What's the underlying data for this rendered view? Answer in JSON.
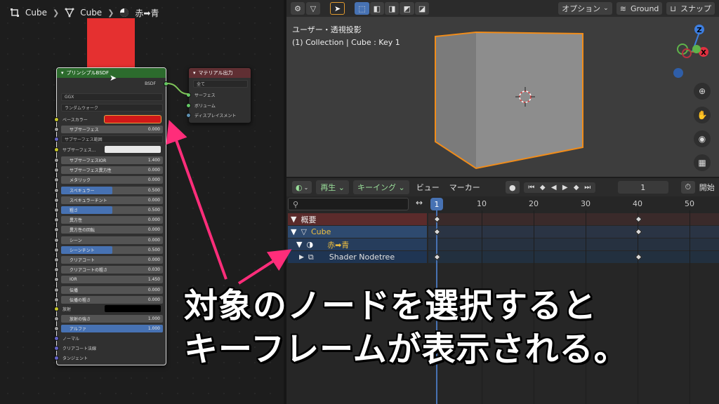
{
  "breadcrumb": {
    "object": "Cube",
    "mesh": "Cube",
    "material": "赤➡青"
  },
  "bsdf_node": {
    "title": "プリンシプルBSDF",
    "output_label": "BSDF",
    "distribution": "GGX",
    "subsurface_method": "ランダムウォーク",
    "base_color_label": "ベースカラー",
    "subsurface_label": "サブサーフェス",
    "subsurface_value": "0.000",
    "subsurface_radius_label": "サブサーフェス範囲",
    "subsurface_color_label": "サブサーフェス…",
    "fields": [
      {
        "label": "サブサーフェスIOR",
        "value": "1.400",
        "fill": 0.0
      },
      {
        "label": "サブサーフェス異方性",
        "value": "0.000",
        "fill": 0.0
      },
      {
        "label": "メタリック",
        "value": "0.000",
        "fill": 0.0
      },
      {
        "label": "スペキュラー",
        "value": "0.500",
        "fill": 0.5
      },
      {
        "label": "スペキュラーチント",
        "value": "0.000",
        "fill": 0.0
      },
      {
        "label": "粗さ",
        "value": "0.500",
        "fill": 0.5
      },
      {
        "label": "異方性",
        "value": "0.000",
        "fill": 0.0
      },
      {
        "label": "異方性の回転",
        "value": "0.000",
        "fill": 0.0
      },
      {
        "label": "シーン",
        "value": "0.000",
        "fill": 0.0
      },
      {
        "label": "シーンチント",
        "value": "0.500",
        "fill": 0.5
      },
      {
        "label": "クリアコート",
        "value": "0.000",
        "fill": 0.0
      },
      {
        "label": "クリアコートの粗さ",
        "value": "0.030",
        "fill": 0.03
      },
      {
        "label": "IOR",
        "value": "1.450",
        "fill": 0.0
      },
      {
        "label": "伝播",
        "value": "0.000",
        "fill": 0.0
      },
      {
        "label": "伝播の粗さ",
        "value": "0.000",
        "fill": 0.0
      }
    ],
    "emission_label": "放射",
    "emission_strength_label": "放射の強さ",
    "emission_strength_value": "1.000",
    "alpha_label": "アルファ",
    "alpha_value": "1.000",
    "normal_label": "ノーマル",
    "clearcoat_normal_label": "クリアコート法線",
    "tangent_label": "タンジェント"
  },
  "output_node": {
    "title": "マテリアル出力",
    "target": "全て",
    "inputs": [
      "サーフェス",
      "ボリューム",
      "ディスプレイスメント"
    ]
  },
  "viewport": {
    "options_label": "オプション",
    "ground_label": "Ground",
    "snap_label": "スナップ",
    "view_name": "ユーザー・透視投影",
    "collection_info": "(1) Collection | Cube : Key 1",
    "gizmo": {
      "z": "Z",
      "x": "X"
    }
  },
  "dopesheet": {
    "menus": {
      "playback": "再生",
      "keying": "キーイング",
      "view": "ビュー",
      "marker": "マーカー"
    },
    "current_frame": "1",
    "start_label": "開始",
    "ruler": [
      "10",
      "20",
      "30",
      "40",
      "50"
    ],
    "playhead_frame": "1",
    "channels": {
      "summary": "概要",
      "object": "Cube",
      "material": "赤➡青",
      "nodetree": "Shader Nodetree"
    }
  },
  "caption": {
    "line1": "対象のノードを選択すると",
    "line2": "キーフレームが表示される。"
  },
  "colors": {
    "base_color": "#e02020",
    "preview": "#e53030",
    "accent_blue": "#4772b3",
    "arrow": "#ff2d7a",
    "selection_orange": "#f08c1a"
  }
}
